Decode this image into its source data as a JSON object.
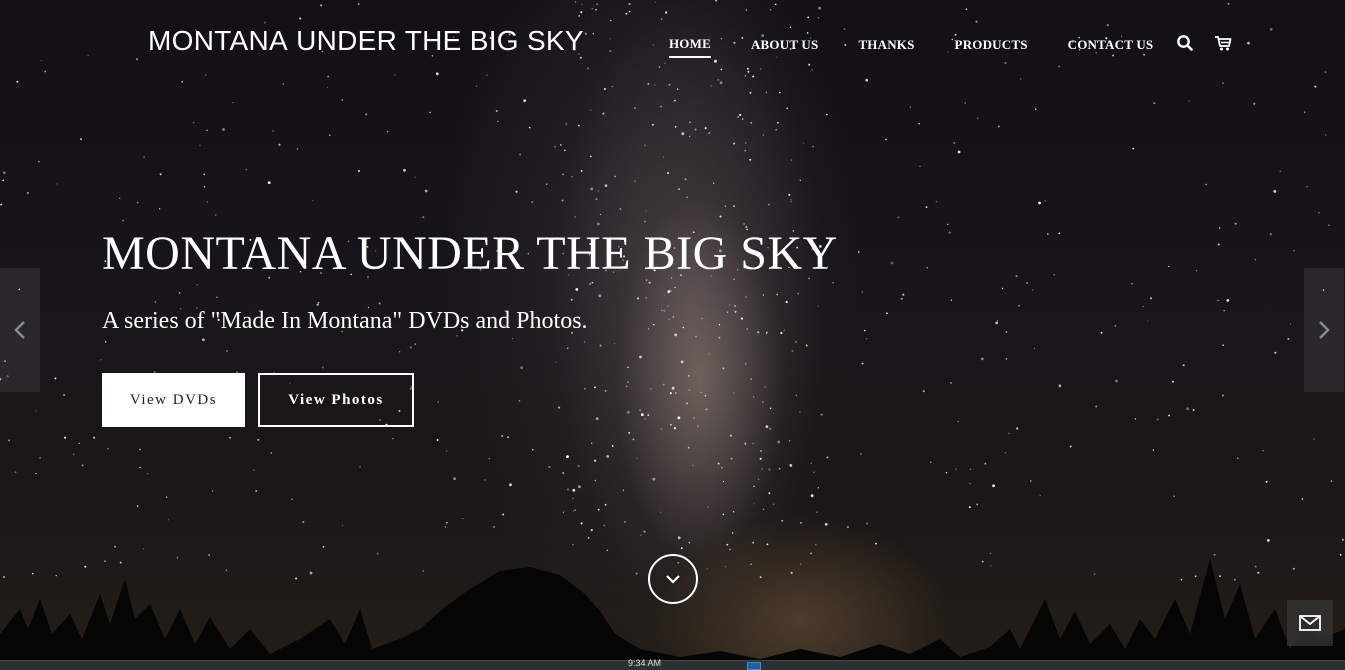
{
  "brand": {
    "light": "MONTANA",
    "bold": "UNDER THE BIG SKY"
  },
  "nav": {
    "items": [
      {
        "label": "HOME",
        "active": true
      },
      {
        "label": "ABOUT US",
        "active": false
      },
      {
        "label": "THANKS",
        "active": false
      },
      {
        "label": "PRODUCTS",
        "active": false
      },
      {
        "label": "CONTACT US",
        "active": false
      }
    ],
    "icons": [
      "search-icon",
      "cart-icon"
    ]
  },
  "hero": {
    "title": "MONTANA UNDER THE BIG SKY",
    "subtitle": "A series of \"Made In Montana\" DVDs and Photos.",
    "buttons": {
      "primary": "View DVDs",
      "secondary": "View Photos"
    }
  },
  "controls": {
    "prev_icon": "chevron-left-icon",
    "next_icon": "chevron-right-icon",
    "scroll_icon": "chevron-down-icon",
    "contact_icon": "mail-icon"
  },
  "taskbar": {
    "clock": "9:34 AM"
  },
  "colors": {
    "text": "#ffffff",
    "button_bg": "#ffffff",
    "button_text": "#222222",
    "sky": "#121015"
  }
}
